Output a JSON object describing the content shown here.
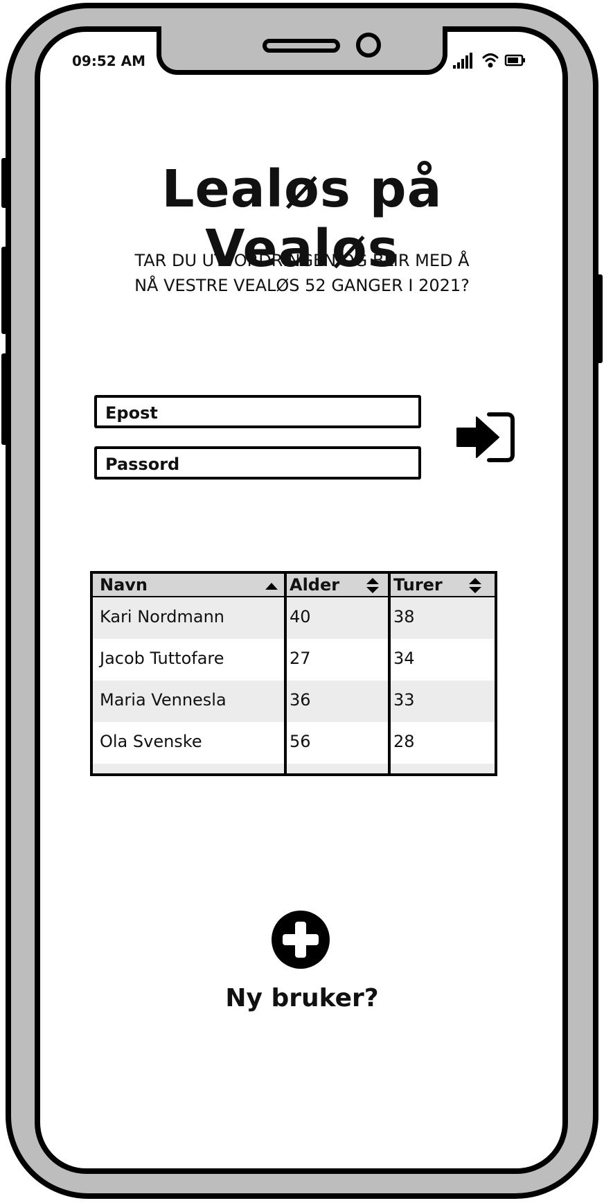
{
  "status_bar": {
    "time": "09:52 AM",
    "icons": [
      "signal-icon",
      "wifi-icon",
      "battery-icon"
    ]
  },
  "header": {
    "title": "Lealøs på Vealøs",
    "subtitle_line1": "TAR DU UTFORDRINGEN OG BLIR MED Å",
    "subtitle_line2": "NÅ VESTRE VEALØS 52 GANGER I 2021?"
  },
  "login": {
    "email_placeholder": "Epost",
    "password_placeholder": "Passord",
    "submit_icon": "sign-in-icon"
  },
  "table": {
    "columns": [
      {
        "label": "Navn",
        "sort": "ascending"
      },
      {
        "label": "Alder",
        "sort": "sortable"
      },
      {
        "label": "Turer",
        "sort": "sortable"
      }
    ],
    "rows": [
      [
        "Kari Nordmann",
        "40",
        "38"
      ],
      [
        "Jacob Tuttofare",
        "27",
        "34"
      ],
      [
        "Maria Vennesla",
        "36",
        "33"
      ],
      [
        "Ola Svenske",
        "56",
        "28"
      ]
    ]
  },
  "new_user": {
    "icon": "plus-circle-icon",
    "label": "Ny bruker?"
  }
}
